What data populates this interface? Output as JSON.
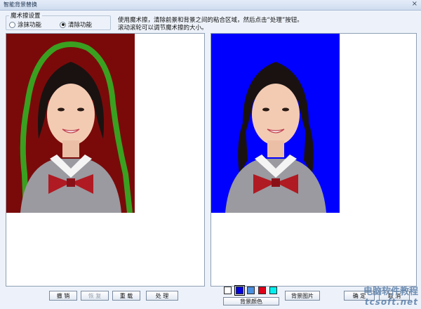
{
  "window": {
    "title": "智能背景替换",
    "close_label": "×"
  },
  "magic_settings": {
    "legend": "魔术擦设置",
    "options": [
      {
        "label": "涂抹功能",
        "selected": false
      },
      {
        "label": "清除功能",
        "selected": true
      }
    ]
  },
  "instructions": {
    "line1": "使用魔术擦，清除前景和背景之间的粘合区域，然后点击“处理”按钮。",
    "line2": "滚动滚轮可以调节魔术擦的大小。"
  },
  "left_panel": {
    "background_color": "#7a0a0a",
    "mask_color": "#3aa020"
  },
  "right_panel": {
    "background_color": "#0000ff"
  },
  "buttons": {
    "undo": "撤 销",
    "redo": "恢 复",
    "redo_disabled": true,
    "reset": "重 载",
    "process": "处 理",
    "bg_color": "背景颜色",
    "bg_image": "背景图片",
    "ok": "确 定",
    "cancel": "取 消"
  },
  "swatches": [
    {
      "name": "white",
      "color": "#ffffff"
    },
    {
      "name": "dark-blue",
      "color": "#0000e0",
      "selected": true
    },
    {
      "name": "light-blue",
      "color": "#4a8fe0"
    },
    {
      "name": "red",
      "color": "#e00018"
    },
    {
      "name": "cyan",
      "color": "#00f0f0"
    }
  ],
  "watermark": {
    "line1": "电脑软件教程",
    "line2": "tcsoft.net"
  }
}
